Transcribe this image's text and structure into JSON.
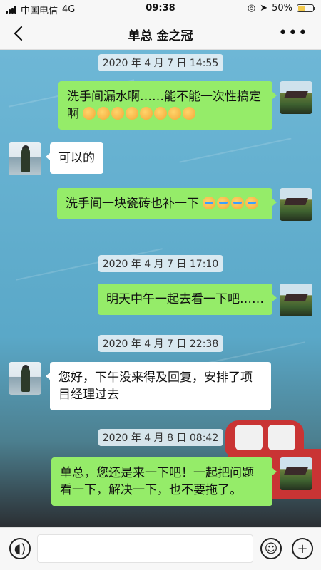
{
  "status_bar": {
    "carrier": "中国电信",
    "network": "4G",
    "time": "09:38",
    "battery_percent": "50%",
    "battery_level": 0.5
  },
  "header": {
    "title": "单总  金之冠",
    "back_icon": "back-chevron-icon",
    "more_icon": "more-dots-icon",
    "more_label": "•••"
  },
  "messages": [
    {
      "type": "timestamp",
      "text": "2020 年 4 月 7 日 14:55"
    },
    {
      "type": "out",
      "text": "洗手间漏水啊……能不能一次性搞定啊",
      "emoji_count": 8,
      "emoji": "sweat-face-icon"
    },
    {
      "type": "in",
      "text": "可以的"
    },
    {
      "type": "out",
      "text": "洗手间一块瓷砖也补一下",
      "emoji_count": 4,
      "emoji": "crying-face-icon"
    },
    {
      "type": "timestamp",
      "text": "2020 年 4 月 7 日 17:10"
    },
    {
      "type": "out",
      "text": "明天中午一起去看一下吧……"
    },
    {
      "type": "timestamp",
      "text": "2020 年 4 月 7 日 22:38"
    },
    {
      "type": "in",
      "text": "您好，下午没来得及回复，安排了项目经理过去"
    },
    {
      "type": "timestamp",
      "text": "2020 年 4 月 8 日 08:42"
    },
    {
      "type": "out",
      "text": "单总，您还是来一下吧！一起把问题看一下，解决一下，也不要拖了。"
    }
  ],
  "input_bar": {
    "voice_icon": "voice-icon",
    "emoji_icon": "emoji-icon",
    "plus_icon": "plus-icon",
    "placeholder": ""
  },
  "colors": {
    "outgoing_bubble": "#95ec69",
    "incoming_bubble": "#ffffff",
    "chat_background": "#6ab4d2"
  }
}
